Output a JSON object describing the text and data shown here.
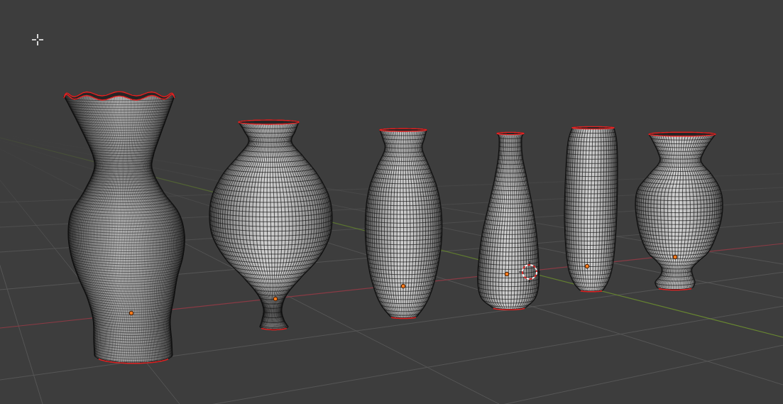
{
  "viewport": {
    "vases": [
      {
        "kind": "fluted"
      },
      {
        "kind": "pear"
      },
      {
        "kind": "tapered"
      },
      {
        "kind": "bottle"
      },
      {
        "kind": "cylinder"
      },
      {
        "kind": "urn"
      }
    ]
  }
}
